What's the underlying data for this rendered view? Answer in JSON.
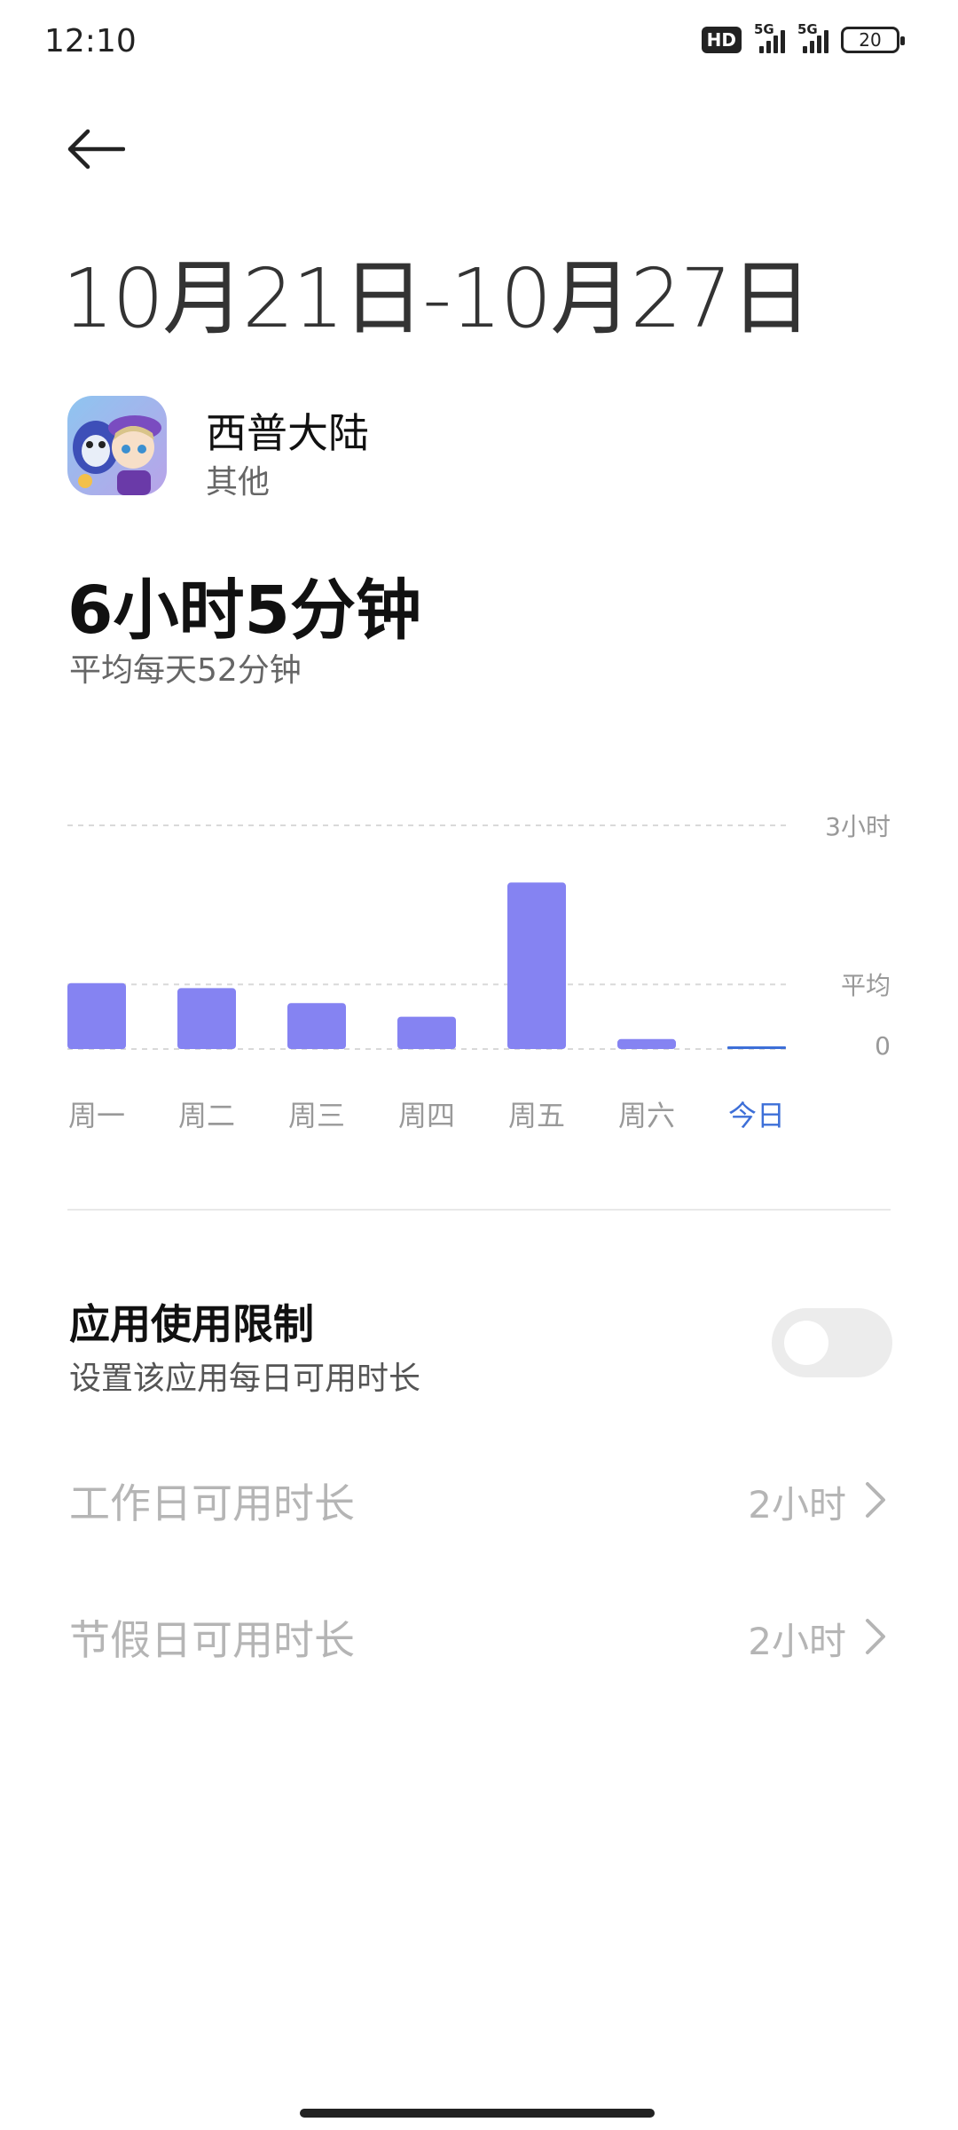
{
  "status_bar": {
    "time": "12:10",
    "hd_label": "HD",
    "network_1": "5G",
    "network_2": "5G",
    "battery": "20"
  },
  "header": {
    "back_icon": "arrow-left-icon",
    "date_range": "10月21日-10月27日"
  },
  "app": {
    "name": "西普大陆",
    "category": "其他",
    "icon": "app-icon-image"
  },
  "summary": {
    "total": "6小时5分钟",
    "average": "平均每天52分钟"
  },
  "chart_data": {
    "type": "bar",
    "categories": [
      "周一",
      "周二",
      "周三",
      "周四",
      "周五",
      "周六",
      "今日"
    ],
    "values_minutes": [
      53,
      49,
      37,
      26,
      134,
      8,
      2
    ],
    "y_tick_labels": [
      "3小时",
      "平均",
      "0"
    ],
    "ylim_minutes": [
      0,
      180
    ],
    "average_minutes": 52,
    "highlight_category": "今日",
    "colors": {
      "bar": "#8583f2",
      "today_bar": "#3d6fd8",
      "gridline": "#d9d9d9",
      "today_label": "#3d6fd8"
    }
  },
  "limit": {
    "title": "应用使用限制",
    "subtitle": "设置该应用每日可用时长",
    "enabled": false
  },
  "settings": [
    {
      "label": "工作日可用时长",
      "value": "2小时"
    },
    {
      "label": "节假日可用时长",
      "value": "2小时"
    }
  ]
}
